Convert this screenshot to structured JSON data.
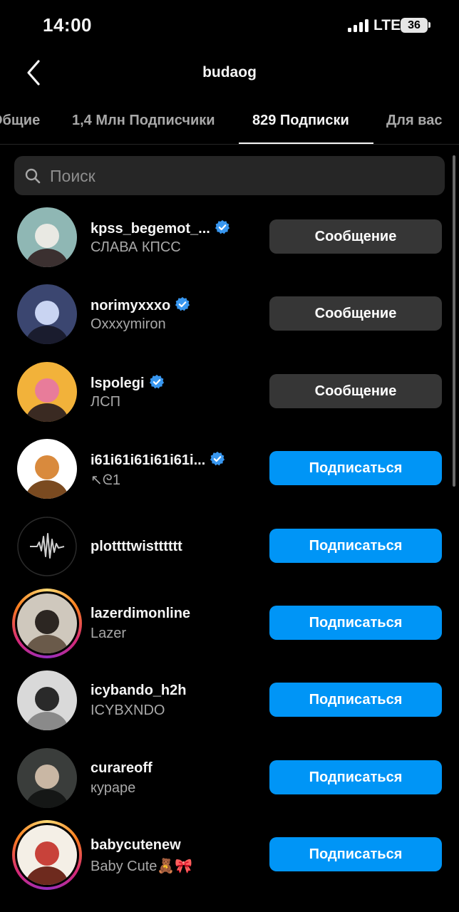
{
  "status_bar": {
    "time": "14:00",
    "network": "LTE",
    "battery": "36"
  },
  "header": {
    "title": "budaog",
    "back_icon": "chevron-left-icon"
  },
  "tabs": [
    {
      "label": "Общие"
    },
    {
      "label": "1,4 Млн Подписчики"
    },
    {
      "label": "829 Подписки"
    },
    {
      "label": "Для вас"
    }
  ],
  "active_tab": "829 Подписки",
  "search": {
    "placeholder": "Поиск",
    "icon": "search-icon"
  },
  "accounts": [
    {
      "username": "kpss_begemot_...",
      "full_name": "СЛАВА КПСС",
      "verified": true,
      "story_ring": false,
      "button": "Сообщение",
      "avatar_colors": [
        "#8fb7b4",
        "#e9e9e3",
        "#3b3030"
      ]
    },
    {
      "username": "norimyxxxo",
      "full_name": "Oxxxymiron",
      "verified": true,
      "story_ring": false,
      "button": "Сообщение",
      "avatar_colors": [
        "#3b4670",
        "#c9d4f2",
        "#1a1c2e"
      ]
    },
    {
      "username": "lspolegi",
      "full_name": "ЛСП",
      "verified": true,
      "story_ring": false,
      "button": "Сообщение",
      "avatar_colors": [
        "#f2b23a",
        "#e87c9a",
        "#3a2a22"
      ]
    },
    {
      "username": "i61i61i61i61i61i...",
      "full_name": "↖ᘓ1",
      "verified": true,
      "story_ring": false,
      "button": "Подписаться",
      "avatar_colors": [
        "#ffffff",
        "#d98a3d",
        "#7a4a20"
      ]
    },
    {
      "username": "plottttwistttttt",
      "full_name": "",
      "verified": false,
      "story_ring": false,
      "button": "Подписаться",
      "avatar_colors": [
        "#000000",
        "#cfcfcf",
        "#2b2b2b"
      ]
    },
    {
      "username": "lazerdimonline",
      "full_name": "Lazer",
      "verified": false,
      "story_ring": true,
      "button": "Подписаться",
      "avatar_colors": [
        "#cfc8bd",
        "#2c2622",
        "#6a5a4a"
      ]
    },
    {
      "username": "icybando_h2h",
      "full_name": "ICYBXNDO",
      "verified": false,
      "story_ring": false,
      "button": "Подписаться",
      "avatar_colors": [
        "#d9d9d9",
        "#2a2a2a",
        "#8a8a8a"
      ]
    },
    {
      "username": "curareoff",
      "full_name": "курaре",
      "verified": false,
      "story_ring": false,
      "button": "Подписаться",
      "avatar_colors": [
        "#3a3d3b",
        "#c9b7a4",
        "#151716"
      ]
    },
    {
      "username": "babycutenew",
      "full_name": "Baby Cute🧸🎀",
      "verified": false,
      "story_ring": true,
      "button": "Подписаться",
      "avatar_colors": [
        "#f4efe6",
        "#c8423a",
        "#6e2a1e"
      ]
    }
  ],
  "colors": {
    "background": "#000000",
    "follow_button": "#0095f6",
    "message_button": "#363636",
    "verified_badge": "#3897f0",
    "secondary_text": "#a8a8a8"
  }
}
